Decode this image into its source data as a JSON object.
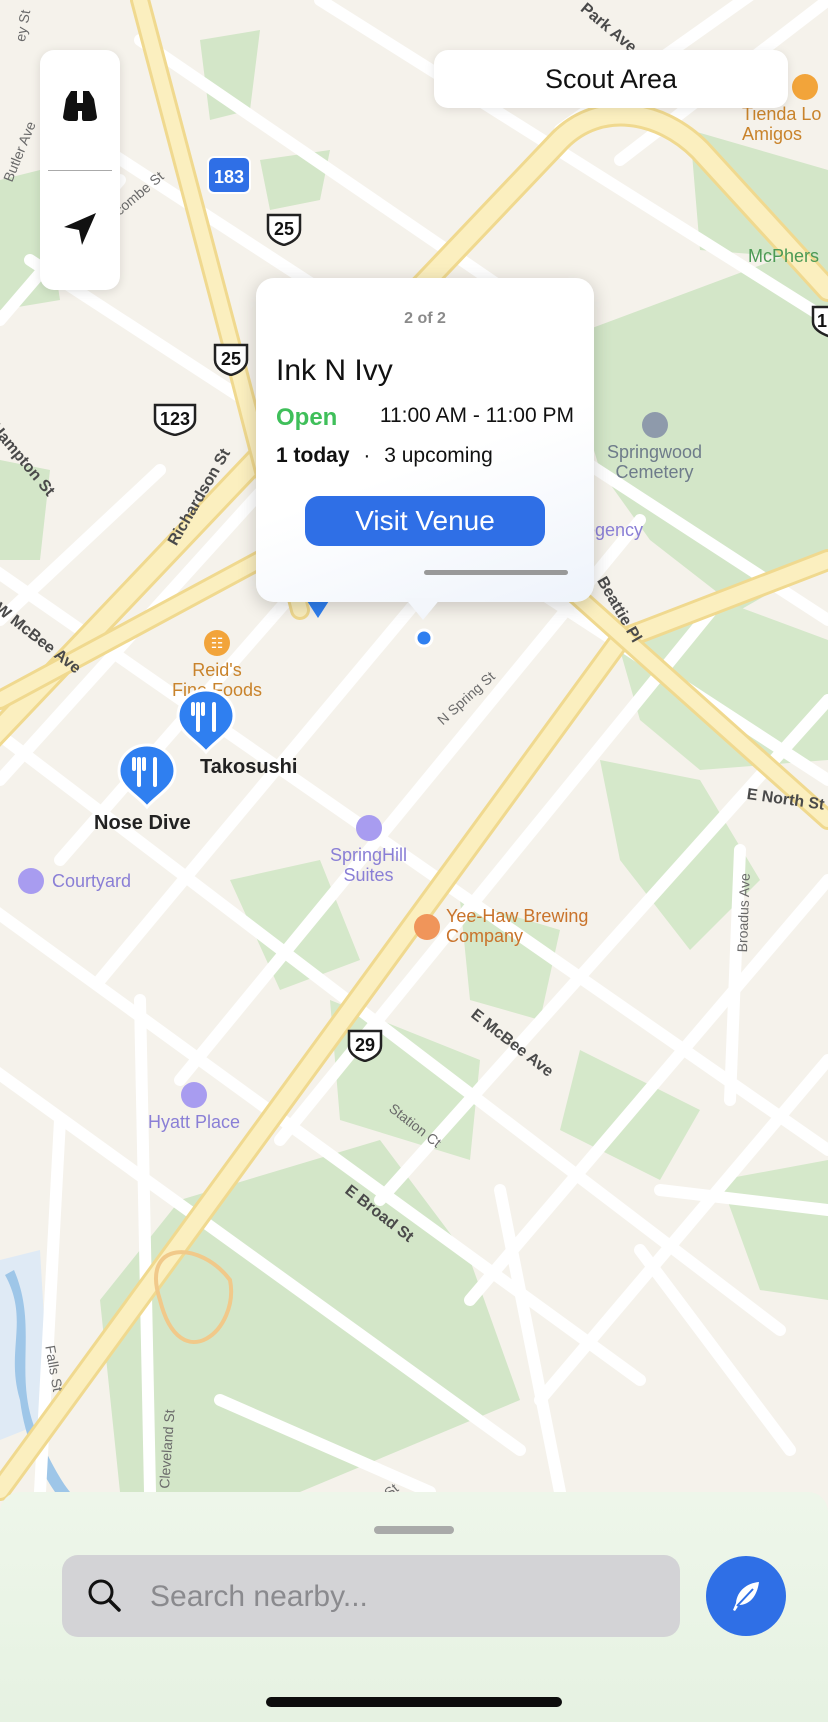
{
  "colors": {
    "accent": "#2f6fe6",
    "open_status": "#3fbf5a",
    "pin": "#2f7ff0"
  },
  "controls": {
    "top_icon": "binoculars-icon",
    "bottom_icon": "location-arrow-icon"
  },
  "scout_area": {
    "label": "Scout Area"
  },
  "popup": {
    "pager": "2 of 2",
    "venue_name": "Ink N Ivy",
    "status": "Open",
    "hours": "11:00 AM - 11:00 PM",
    "today": "1 today",
    "separator": "·",
    "upcoming": "3 upcoming",
    "visit_label": "Visit Venue"
  },
  "map": {
    "pins": [
      {
        "label": "Takosushi",
        "icon": "fork-knife-icon"
      },
      {
        "label": "Nose Dive",
        "icon": "fork-knife-icon"
      }
    ],
    "pois": {
      "reids": "Reid's\nFine Foods",
      "springhill": "SpringHill\nSuites",
      "yeehaw": "Yee-Haw Brewing\nCompany",
      "courtyard": "Courtyard",
      "hyatt": "Hyatt Place",
      "springwood": "Springwood\nCemetery",
      "tienda": "Tienda Lo\nAmigos",
      "mcpherson": "McPhers",
      "regency": "Regency"
    },
    "streets": {
      "richardson": "Richardson St",
      "beattie": "Beattie Pl",
      "w_mcbee": "W McBee Ave",
      "n_spring": "N Spring St",
      "e_north": "E North St",
      "e_mcbee": "E McBee Ave",
      "station": "Station Ct",
      "e_broad": "E Broad St",
      "broadus": "Broadus Ave",
      "falls": "Falls St",
      "cleveland": "Cleveland St",
      "butler": "Butler Ave",
      "hampton": "Hampton St",
      "park": "Park Ave",
      "north_top": "ey St",
      "buncombe": "Buncombe St",
      "falls_bottom": "e St"
    },
    "shields": {
      "r183": "183",
      "us25a": "25",
      "us25b": "25",
      "us123": "123",
      "us29": "29",
      "edge": "1"
    }
  },
  "search": {
    "placeholder": "Search nearby..."
  },
  "fab": {
    "icon": "feather-icon"
  }
}
